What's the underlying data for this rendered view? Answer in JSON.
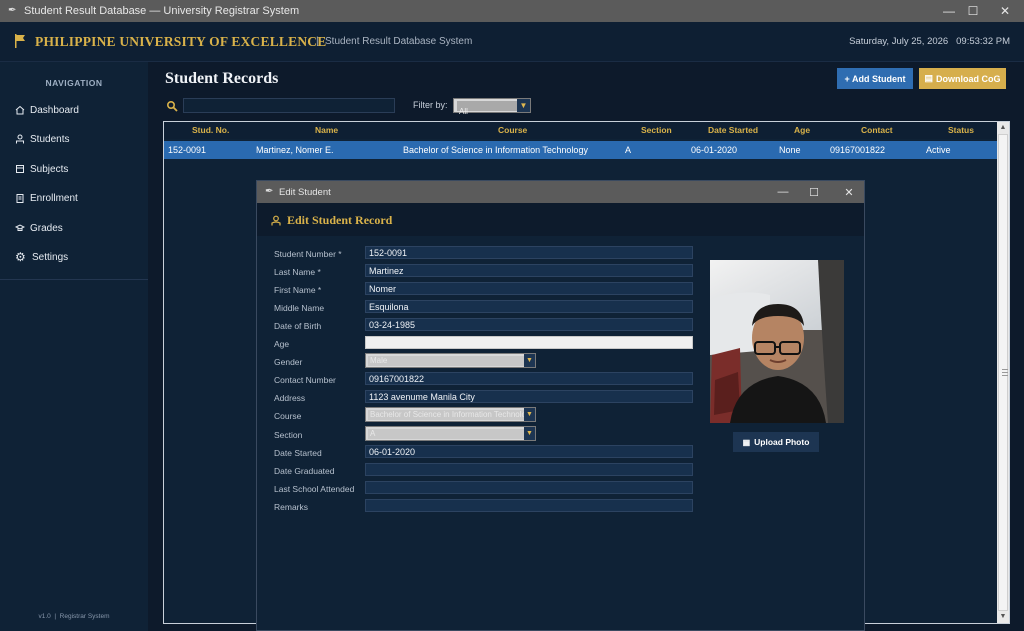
{
  "window": {
    "title": "Student Result Database — University Registrar System",
    "controls": [
      "minimize",
      "maximize",
      "close"
    ]
  },
  "header": {
    "brand": "PHILIPPINE UNIVERSITY OF EXCELLENCE",
    "separator": "|",
    "subtitle": "Student Result Database System",
    "datetime": "Saturday, July 25, 2026   09:53:32 PM"
  },
  "sidebar": {
    "title": "NAVIGATION",
    "items": [
      {
        "label": "Dashboard",
        "icon": "home-icon"
      },
      {
        "label": "Students",
        "icon": "student-icon"
      },
      {
        "label": "Subjects",
        "icon": "book-icon"
      },
      {
        "label": "Enrollment",
        "icon": "clipboard-icon"
      },
      {
        "label": "Grades",
        "icon": "grade-icon"
      },
      {
        "label": "Settings",
        "icon": "gear-icon"
      }
    ],
    "footer": "v1.0  |  Registrar System"
  },
  "main": {
    "title": "Student Records",
    "add_button": "+ Add Student",
    "cog_button": "Download CoG",
    "search_placeholder": "",
    "filter_label": "Filter by:",
    "filter_value": "All"
  },
  "table": {
    "columns": [
      "Stud. No.",
      "Name",
      "Course",
      "Section",
      "Date Started",
      "Age",
      "Contact",
      "Status"
    ],
    "rows": [
      {
        "stud_no": "152-0091",
        "name": "Martinez, Nomer E.",
        "course": "Bachelor of Science in Information Technology",
        "section": "A",
        "date_started": "06-01-2020",
        "age": "None",
        "contact": "09167001822",
        "status": "Active"
      }
    ]
  },
  "dialog": {
    "window_title": "Edit Student",
    "heading": "Edit Student Record",
    "fields": {
      "student_number": {
        "label": "Student Number *",
        "value": "152-0091"
      },
      "last_name": {
        "label": "Last Name *",
        "value": "Martinez"
      },
      "first_name": {
        "label": "First Name *",
        "value": "Nomer"
      },
      "middle_name": {
        "label": "Middle Name",
        "value": "Esquilona"
      },
      "date_of_birth": {
        "label": "Date of Birth",
        "value": "03-24-1985"
      },
      "age": {
        "label": "Age",
        "value": ""
      },
      "gender": {
        "label": "Gender",
        "value": "Male"
      },
      "contact_number": {
        "label": "Contact Number",
        "value": "09167001822"
      },
      "address": {
        "label": "Address",
        "value": "1123 avenume Manila City"
      },
      "course": {
        "label": "Course",
        "value": "Bachelor of Science in Information Technology"
      },
      "section": {
        "label": "Section",
        "value": "A"
      },
      "date_started": {
        "label": "Date Started",
        "value": "06-01-2020"
      },
      "date_graduated": {
        "label": "Date Graduated",
        "value": ""
      },
      "last_school": {
        "label": "Last School Attended",
        "value": ""
      },
      "remarks": {
        "label": "Remarks",
        "value": ""
      }
    },
    "upload_button": "Upload Photo"
  },
  "colors": {
    "accent_gold": "#d9b24a",
    "accent_blue": "#2f6db1",
    "background": "#0d1a2b",
    "sidebar": "#0f2236"
  }
}
